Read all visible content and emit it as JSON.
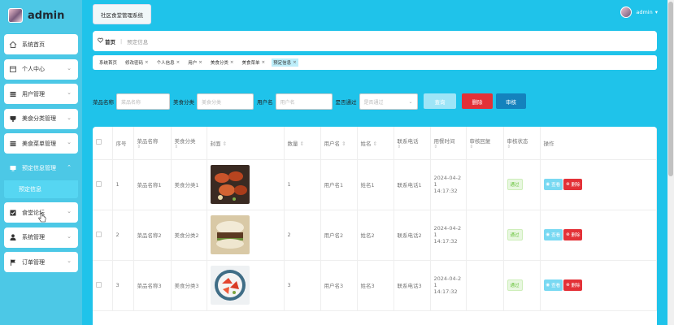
{
  "brand": {
    "name": "admin"
  },
  "sidebar": {
    "items": [
      {
        "label": "系统首页",
        "icon": "home-icon"
      },
      {
        "label": "个人中心",
        "icon": "calendar-icon"
      },
      {
        "label": "用户管理",
        "icon": "list-icon"
      },
      {
        "label": "美食分类管理",
        "icon": "cup-icon"
      },
      {
        "label": "美食菜单管理",
        "icon": "list-icon"
      },
      {
        "label": "预定信息管理",
        "icon": "monitor-icon"
      },
      {
        "label": "食堂论坛",
        "icon": "checkbox-icon"
      },
      {
        "label": "系统管理",
        "icon": "user-icon"
      },
      {
        "label": "订单管理",
        "icon": "flag-icon"
      }
    ],
    "sub_active": "预定信息"
  },
  "header": {
    "system_title": "社区食堂管理系统",
    "user": "admin",
    "user_caret": "▾"
  },
  "breadcrumb": {
    "home": "首页",
    "current": "预定信息"
  },
  "tabs": [
    "系统首页",
    "修改密码",
    "个人信息",
    "用户",
    "美食分类",
    "美食菜单",
    "预定信息"
  ],
  "tab_close": "×",
  "search": {
    "fields": [
      {
        "label": "菜品名称",
        "placeholder": "菜品名称"
      },
      {
        "label": "美食分类",
        "placeholder": "美食分类"
      },
      {
        "label": "用户名",
        "placeholder": "用户名"
      }
    ],
    "select": {
      "label": "是否通过",
      "placeholder": "是否通过"
    },
    "query_label": "查询",
    "delete_label": "删除",
    "audit_label": "审核"
  },
  "table": {
    "columns": [
      "序号",
      "菜品名称",
      "美食分类",
      "封面",
      "数量",
      "用户名",
      "姓名",
      "联系电话",
      "用餐时间",
      "审核回复",
      "审核状态",
      "操作"
    ],
    "rows": [
      {
        "idx": "1",
        "name": "菜品名称1",
        "cat": "美食分类1",
        "qty": "1",
        "user": "用户名1",
        "real": "姓名1",
        "phone": "联系电话1",
        "time_a": "2024-04-2",
        "time_b": "1 14:17:32",
        "reply": "",
        "status": "通过"
      },
      {
        "idx": "2",
        "name": "菜品名称2",
        "cat": "美食分类2",
        "qty": "2",
        "user": "用户名2",
        "real": "姓名2",
        "phone": "联系电话2",
        "time_a": "2024-04-2",
        "time_b": "1 14:17:32",
        "reply": "",
        "status": "通过"
      },
      {
        "idx": "3",
        "name": "菜品名称3",
        "cat": "美食分类3",
        "qty": "3",
        "user": "用户名3",
        "real": "姓名3",
        "phone": "联系电话3",
        "time_a": "2024-04-2",
        "time_b": "1 14:17:32",
        "reply": "",
        "status": "通过"
      }
    ],
    "view_label": "查看",
    "del_label": "删除"
  },
  "colors": {
    "main_bg": "#1fc3ea",
    "sidebar_bg": "#4cc8e6",
    "danger": "#e33137",
    "audit": "#1482bd"
  }
}
